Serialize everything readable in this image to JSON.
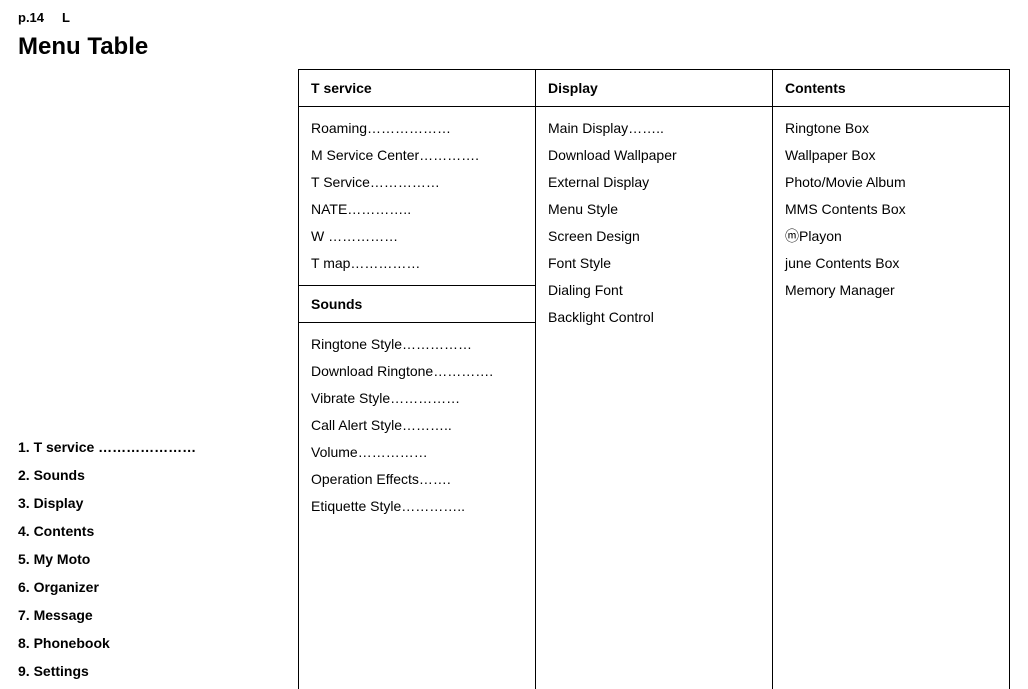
{
  "page_label_1": "p.14",
  "page_label_2": "L",
  "title": "Menu Table",
  "left_menu": [
    "1. T service …………………",
    "2. Sounds",
    "3. Display",
    "4. Contents",
    "5. My Moto",
    "6. Organizer",
    "7. Message",
    "8. Phonebook",
    "9. Settings"
  ],
  "col1": {
    "header": "T service",
    "items": [
      "Roaming………………",
      "M Service Center………….",
      "T Service……………",
      "NATE…………..",
      "W ……………",
      "T map……………"
    ],
    "sub_header": "Sounds",
    "sub_items": [
      "Ringtone Style……………",
      "Download Ringtone………….",
      "Vibrate Style……………",
      "Call Alert Style………..",
      "Volume……………",
      "Operation Effects…….",
      "Etiquette Style………….."
    ]
  },
  "col2": {
    "header": "Display",
    "items": [
      "Main Display……..",
      "Download Wallpaper",
      "External Display",
      "Menu Style",
      "Screen Design",
      "Font Style",
      "Dialing Font",
      "Backlight Control"
    ]
  },
  "col3": {
    "header": "Contents",
    "items": [
      "Ringtone Box",
      "Wallpaper Box",
      "Photo/Movie Album",
      "MMS Contents Box",
      "ⓜPlayon",
      "june Contents Box",
      "Memory Manager"
    ]
  }
}
